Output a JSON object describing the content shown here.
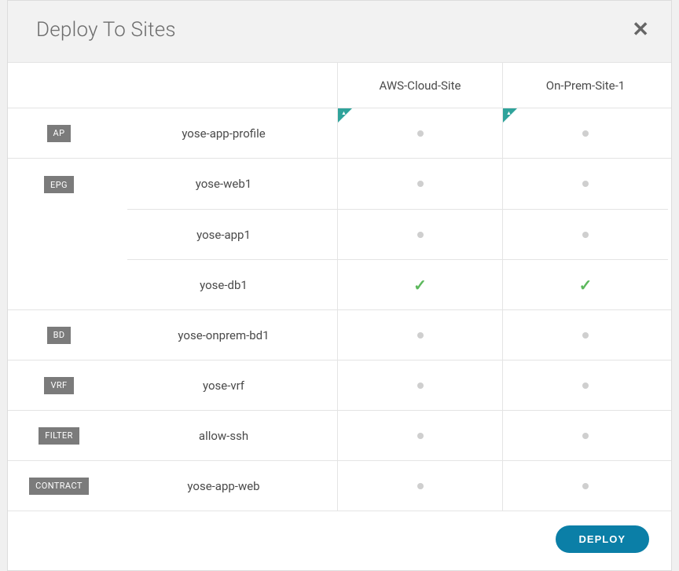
{
  "dialog": {
    "title": "Deploy To Sites"
  },
  "sites": [
    {
      "id": "aws",
      "label": "AWS-Cloud-Site"
    },
    {
      "id": "onprem",
      "label": "On-Prem-Site-1"
    }
  ],
  "groups": [
    {
      "type": "AP",
      "typeLabel": "AP",
      "rows": [
        {
          "name": "yose-app-profile",
          "states": {
            "aws": "dot",
            "onprem": "dot"
          },
          "corner": {
            "aws": true,
            "onprem": true
          }
        }
      ]
    },
    {
      "type": "EPG",
      "typeLabel": "EPG",
      "rows": [
        {
          "name": "yose-web1",
          "states": {
            "aws": "dot",
            "onprem": "dot"
          }
        },
        {
          "name": "yose-app1",
          "states": {
            "aws": "dot",
            "onprem": "dot"
          }
        },
        {
          "name": "yose-db1",
          "states": {
            "aws": "check",
            "onprem": "check"
          }
        }
      ]
    },
    {
      "type": "BD",
      "typeLabel": "BD",
      "rows": [
        {
          "name": "yose-onprem-bd1",
          "states": {
            "aws": "dot",
            "onprem": "dot"
          }
        }
      ]
    },
    {
      "type": "VRF",
      "typeLabel": "VRF",
      "rows": [
        {
          "name": "yose-vrf",
          "states": {
            "aws": "dot",
            "onprem": "dot"
          }
        }
      ]
    },
    {
      "type": "FILTER",
      "typeLabel": "FILTER",
      "rows": [
        {
          "name": "allow-ssh",
          "states": {
            "aws": "dot",
            "onprem": "dot"
          }
        }
      ]
    },
    {
      "type": "CONTRACT",
      "typeLabel": "CONTRACT",
      "rows": [
        {
          "name": "yose-app-web",
          "states": {
            "aws": "dot",
            "onprem": "dot"
          }
        }
      ]
    }
  ],
  "footer": {
    "deployLabel": "DEPLOY"
  }
}
